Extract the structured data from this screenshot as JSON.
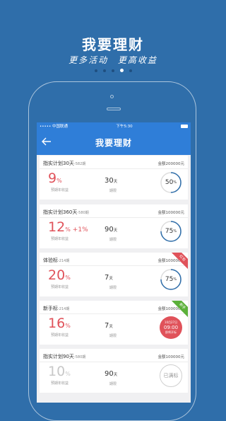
{
  "hero": {
    "title": "我要理财",
    "subtitle_left": "更多活动",
    "subtitle_right": "更高收益"
  },
  "status_bar": {
    "carrier": "••••• 中国联通",
    "time": "下午5:30"
  },
  "nav": {
    "title": "我要理财"
  },
  "products": [
    {
      "name": "指实计划30天",
      "period": "-582期",
      "amount": "金额200000元",
      "rate": "9",
      "rate_unit": "%",
      "bonus": "",
      "rate_label": "预期年收益",
      "term": "30",
      "term_unit": "天",
      "term_label": "期限",
      "progress_text": "50",
      "progress_unit": "%",
      "progress": 0.5,
      "gray": false
    },
    {
      "name": "指实计划360天",
      "period": "-580期",
      "amount": "金额100000元",
      "rate": "12",
      "rate_unit": "%",
      "bonus": "+1%",
      "rate_label": "预期年收益",
      "term": "90",
      "term_unit": "天",
      "term_label": "期限",
      "progress_text": "75",
      "progress_unit": "%",
      "progress": 0.75,
      "gray": false
    },
    {
      "name": "体验标",
      "period": "-214期",
      "amount": "金额100000元",
      "rate": "20",
      "rate_unit": "%",
      "bonus": "",
      "rate_label": "预期年收益",
      "term": "7",
      "term_unit": "天",
      "term_label": "期限",
      "progress_text": "75",
      "progress_unit": "%",
      "progress": 0.75,
      "ribbon": "红包",
      "gray": false
    },
    {
      "name": "新手标",
      "period": "-214期",
      "amount": "金额100000元",
      "rate": "16",
      "rate_unit": "%",
      "bonus": "",
      "rate_label": "预期年收益",
      "term": "7",
      "term_unit": "天",
      "term_label": "期限",
      "countdown_date": "10月27日",
      "countdown_time": "09:00",
      "countdown_label": "即将开标",
      "ribbon": "新手",
      "gray": false
    },
    {
      "name": "指实计划90天",
      "period": "-580期",
      "amount": "金额100000元",
      "rate": "10",
      "rate_unit": "%",
      "bonus": "",
      "rate_label": "预期年收益",
      "term": "90",
      "term_unit": "天",
      "term_label": "期限",
      "status": "已满标",
      "gray": true
    }
  ],
  "colors": {
    "background": "#2f6eaa",
    "primary": "#2f7ed8",
    "rate_red": "#e0525a",
    "progress_blue": "#2f6eaa",
    "badge_green": "#5bb03a"
  }
}
